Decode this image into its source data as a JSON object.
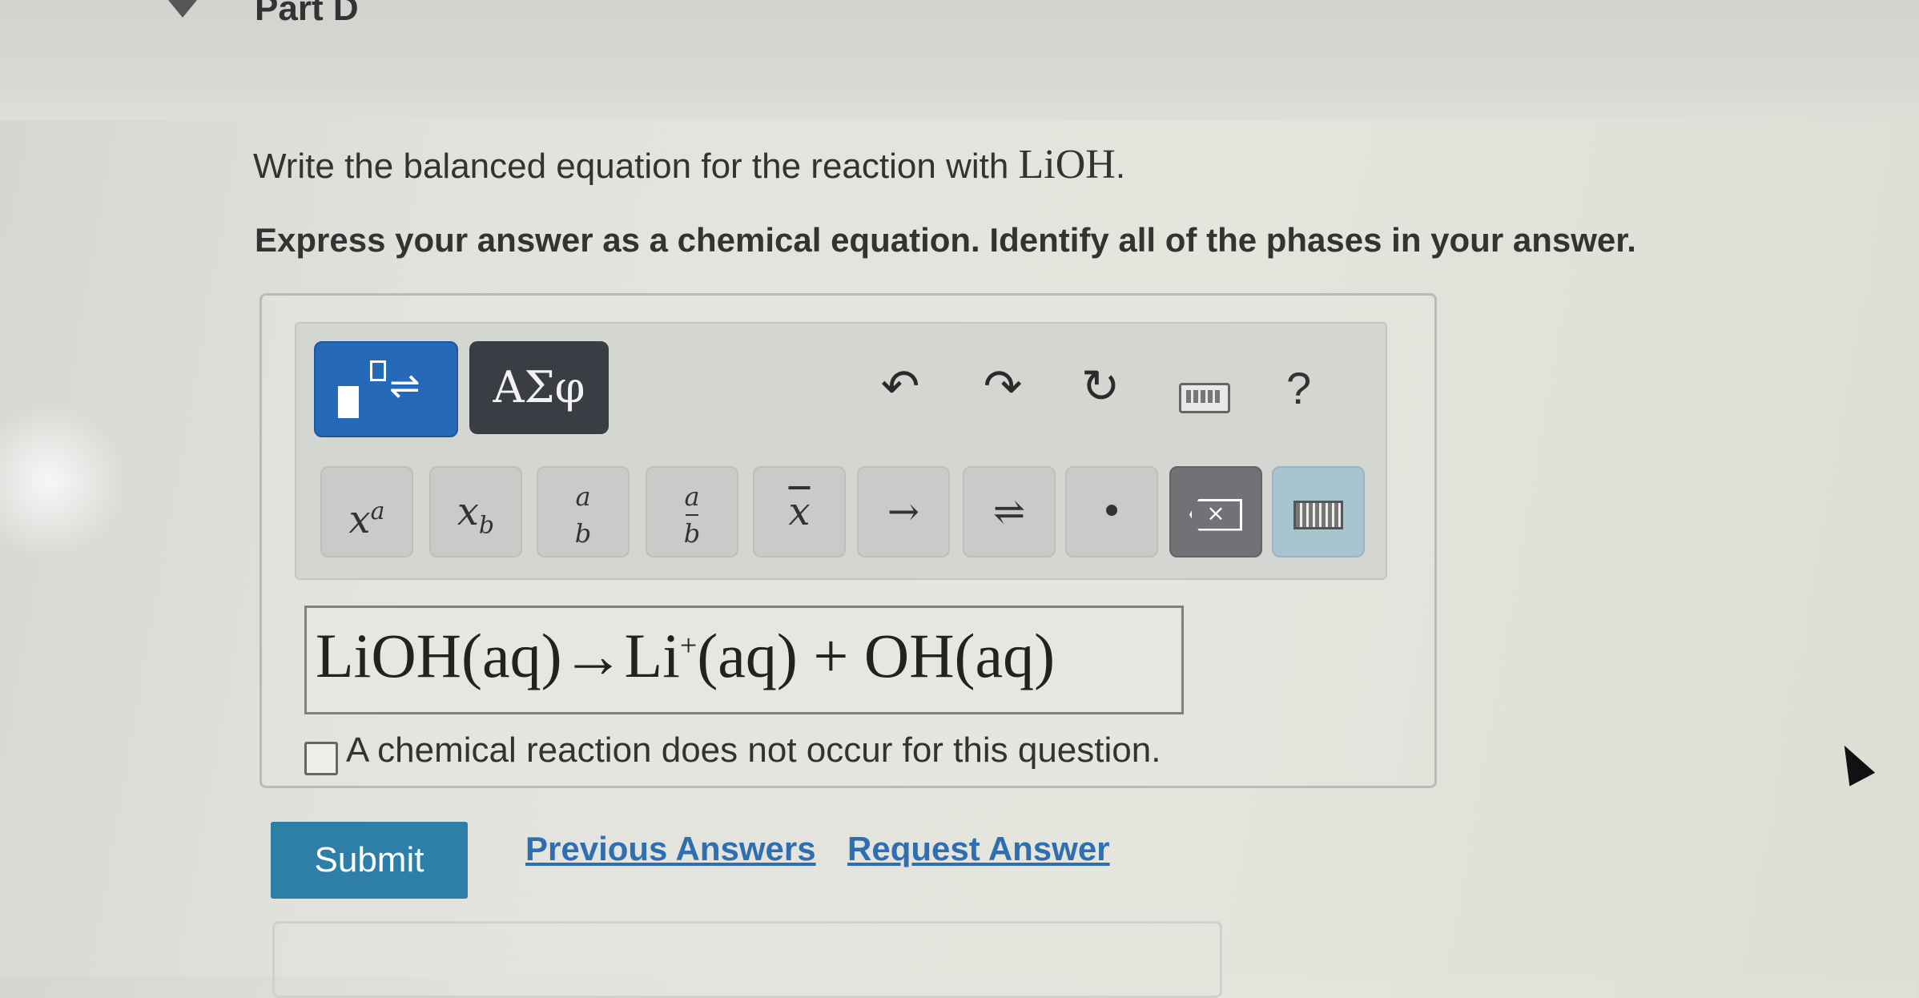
{
  "part": {
    "title": "Part D"
  },
  "question": {
    "text": "Write the balanced equation for the reaction with ",
    "formula": "LiOH",
    "end": "."
  },
  "instruction": "Express your answer as a chemical equation. Identify all of the phases in your answer.",
  "toolbar": {
    "greek_label": "ΑΣφ",
    "undo_icon": "↶",
    "redo_icon": "↷",
    "reset_icon": "↻",
    "help_label": "?",
    "keys": {
      "superscript": "x",
      "superscript_sup": "a",
      "subscript": "x",
      "subscript_sub": "b",
      "frac_num": "a",
      "frac_den": "b",
      "frac2_num": "a",
      "frac2_den": "b",
      "overbar": "x",
      "arrow": "→",
      "equilibrium": "⇌",
      "dot": "•",
      "backspace_mark": "×"
    }
  },
  "answer": {
    "part1": "LiOH(aq)",
    "arrow": "→",
    "part2": "Li",
    "charge": "+",
    "part3": "(aq) + OH(aq)"
  },
  "no_reaction_label": "A chemical reaction does not occur for this question.",
  "actions": {
    "submit_label": "Submit",
    "previous_answers_label": "Previous Answers",
    "request_answer_label": "Request Answer"
  }
}
